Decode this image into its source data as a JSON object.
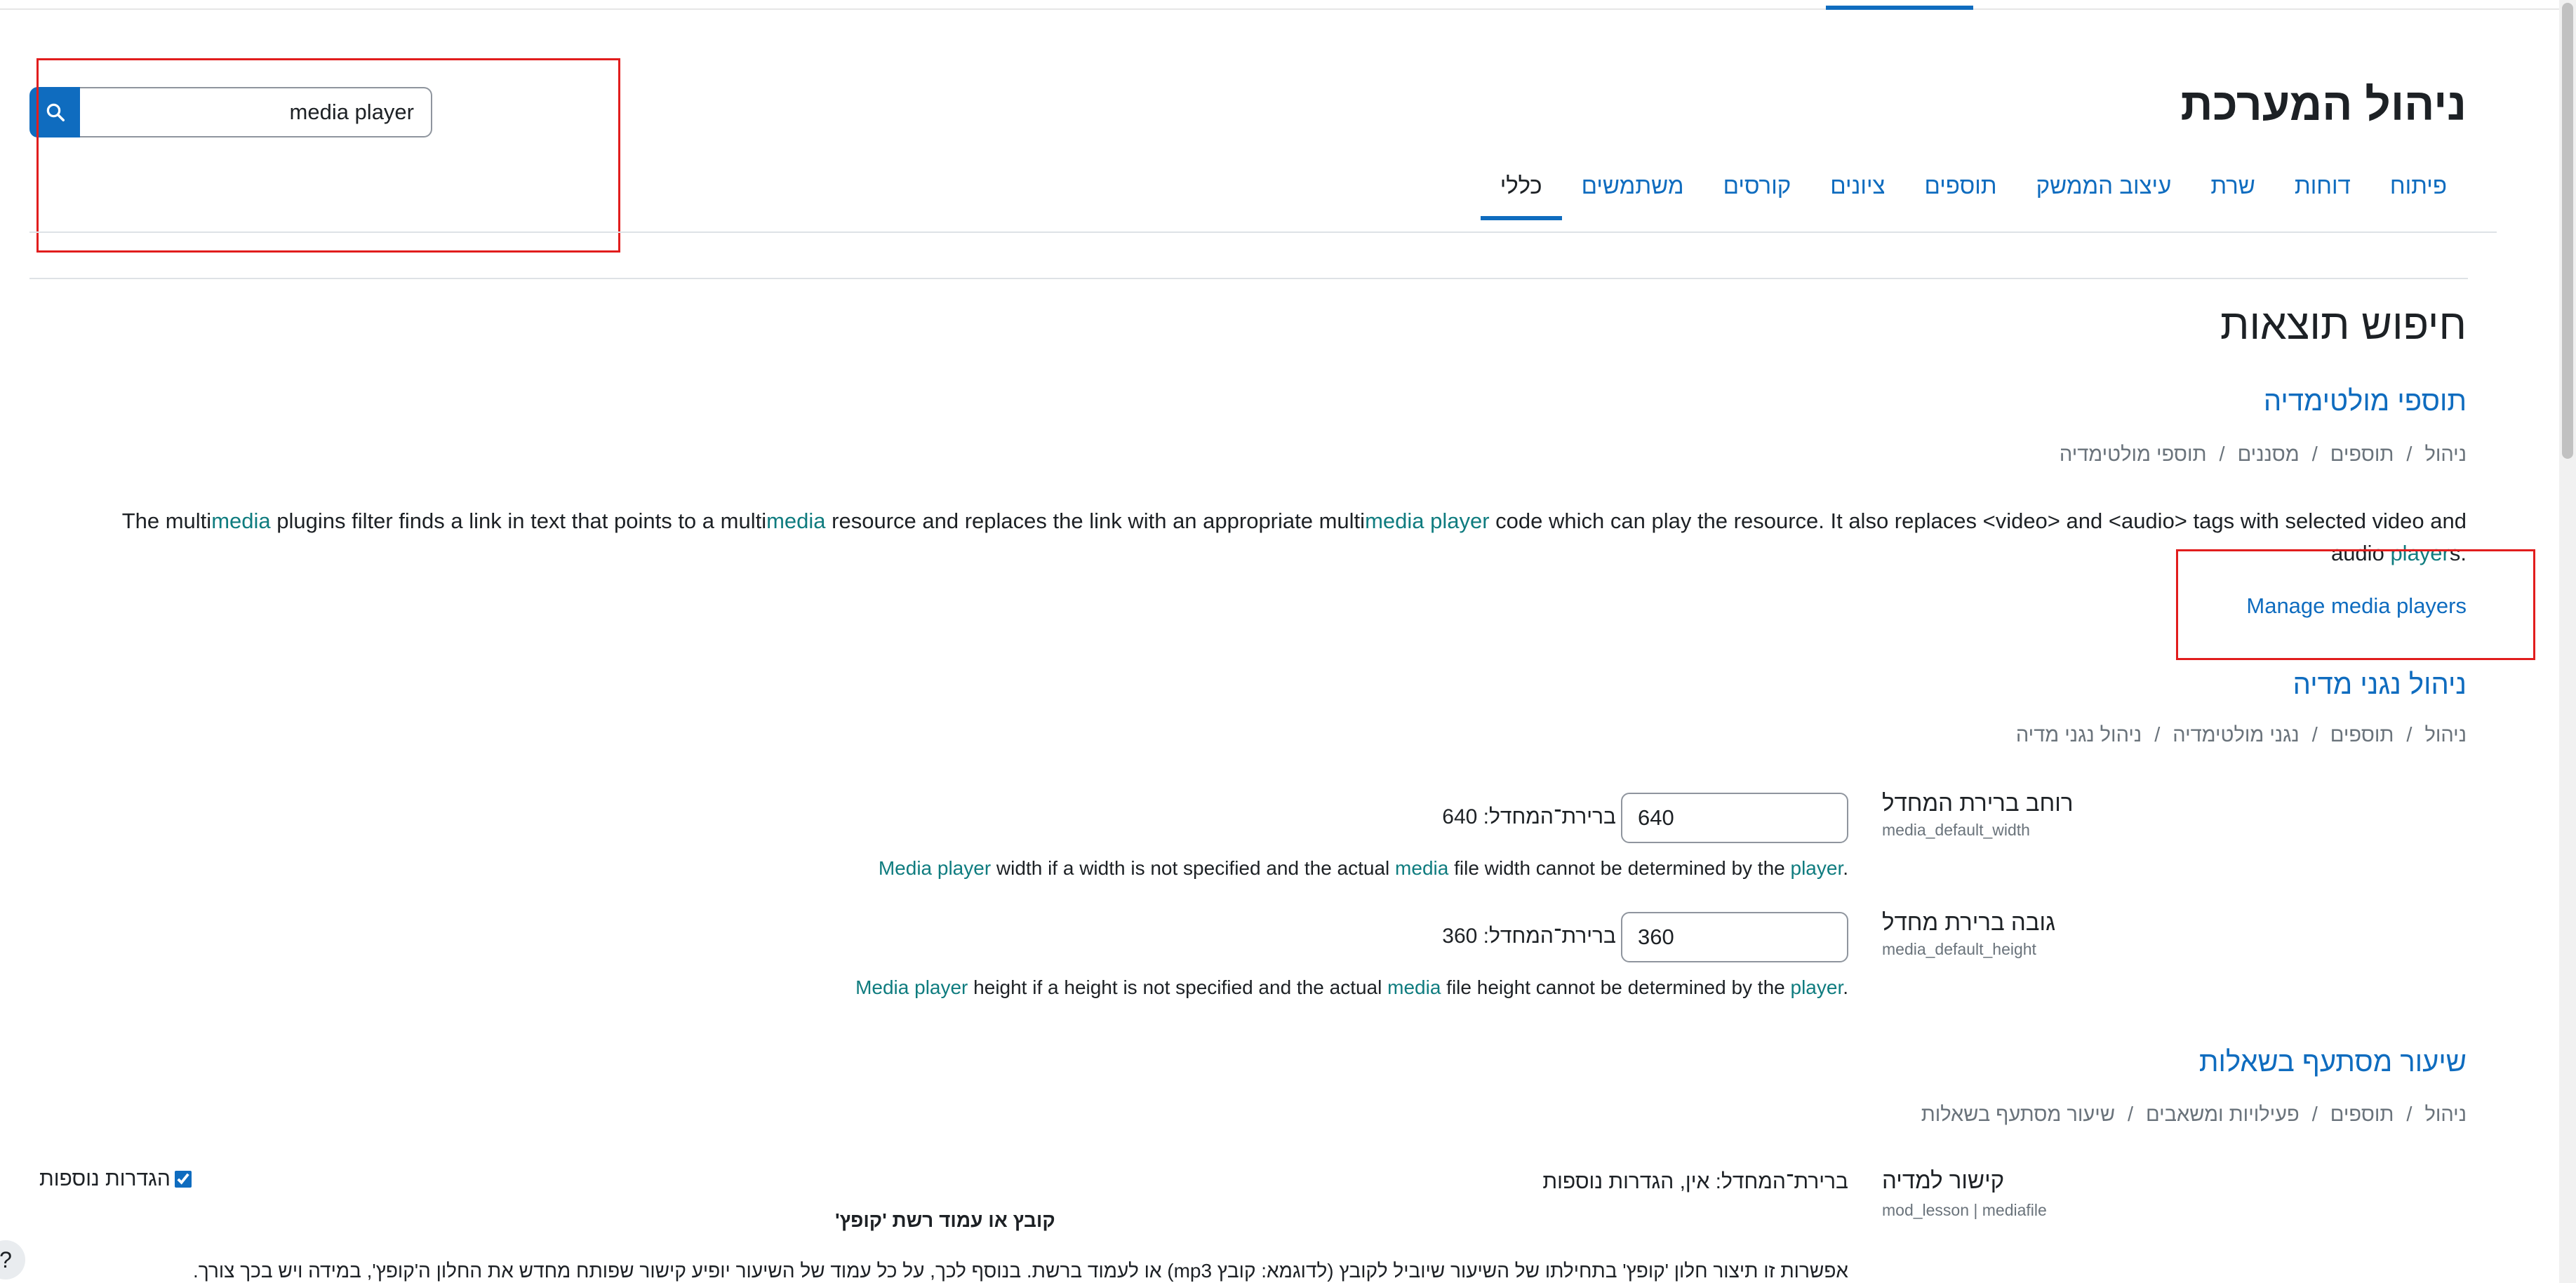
{
  "search": {
    "value": "media player"
  },
  "page_title": "ניהול המערכת",
  "tabs": [
    {
      "label": "כללי",
      "active": true
    },
    {
      "label": "משתמשים"
    },
    {
      "label": "קורסים"
    },
    {
      "label": "ציונים"
    },
    {
      "label": "תוספים"
    },
    {
      "label": "עיצוב הממשק"
    },
    {
      "label": "שרת"
    },
    {
      "label": "דוחות"
    },
    {
      "label": "פיתוח"
    }
  ],
  "results_heading": "חיפוש תוצאות",
  "section1": {
    "title": "תוספי מולטימדיה",
    "breadcrumb": [
      "ניהול",
      "תוספים",
      "מסננים",
      "תוספי מולטימדיה"
    ],
    "desc": {
      "p1": "The multi",
      "h1": "media",
      "p2": " plugins filter finds a link in text that points to a multi",
      "h2": "media",
      "p3": " resource and replaces the link with an appropriate multi",
      "h3": "media player",
      "p4": " code which can play the resource. It also replaces <video> and <audio> tags with selected video and audio",
      "h4": "player",
      "p5": "s."
    },
    "manage_link": "Manage media players"
  },
  "section2": {
    "title": "ניהול נגני מדיה",
    "breadcrumb": [
      "ניהול",
      "תוספים",
      "נגני מולטימדיה",
      "ניהול נגני מדיה"
    ],
    "width": {
      "label": "רוחב ברירת המחדל",
      "key": "media_default_width",
      "value": "640",
      "default": "ברירת־המחדל: 640",
      "desc": {
        "h1": "Media player",
        "t1": " width if a width is not specified and the actual ",
        "h2": "media",
        "t2": " file width cannot be determined by the ",
        "h3": "player",
        "t3": "."
      }
    },
    "height": {
      "label": "גובה ברירת מחדל",
      "key": "media_default_height",
      "value": "360",
      "default": "ברירת־המחדל: 360",
      "desc": {
        "h1": "Media player",
        "t1": " height if a height is not specified and the actual ",
        "h2": "media",
        "t2": " file height cannot be determined by the ",
        "h3": "player",
        "t3": "."
      }
    }
  },
  "section3": {
    "title": "שיעור מסתעף בשאלות",
    "breadcrumb": [
      "ניהול",
      "תוספים",
      "פעילויות ומשאבים",
      "שיעור מסתעף בשאלות"
    ],
    "setting": {
      "label": "קישור למדיה",
      "key": "mod_lesson | mediafile",
      "default": "ברירת־המחדל: אין, הגדרות נוספות",
      "advanced_label": "הגדרות נוספות",
      "advanced_checked": true,
      "sub_label": "קובץ או עמוד רשת 'קופץ'",
      "desc": "אפשרות זו תיצור חלון 'קופץ' בתחילתו של השיעור שיוביל לקובץ (לדוגמא: קובץ mp3) או לעמוד ברשת. בנוסף לכך, על כל עמוד של השיעור יופיע קישור שפותח מחדש את החלון ה'קופץ', במידה ויש בכך צורך."
    }
  },
  "help_button": "?"
}
